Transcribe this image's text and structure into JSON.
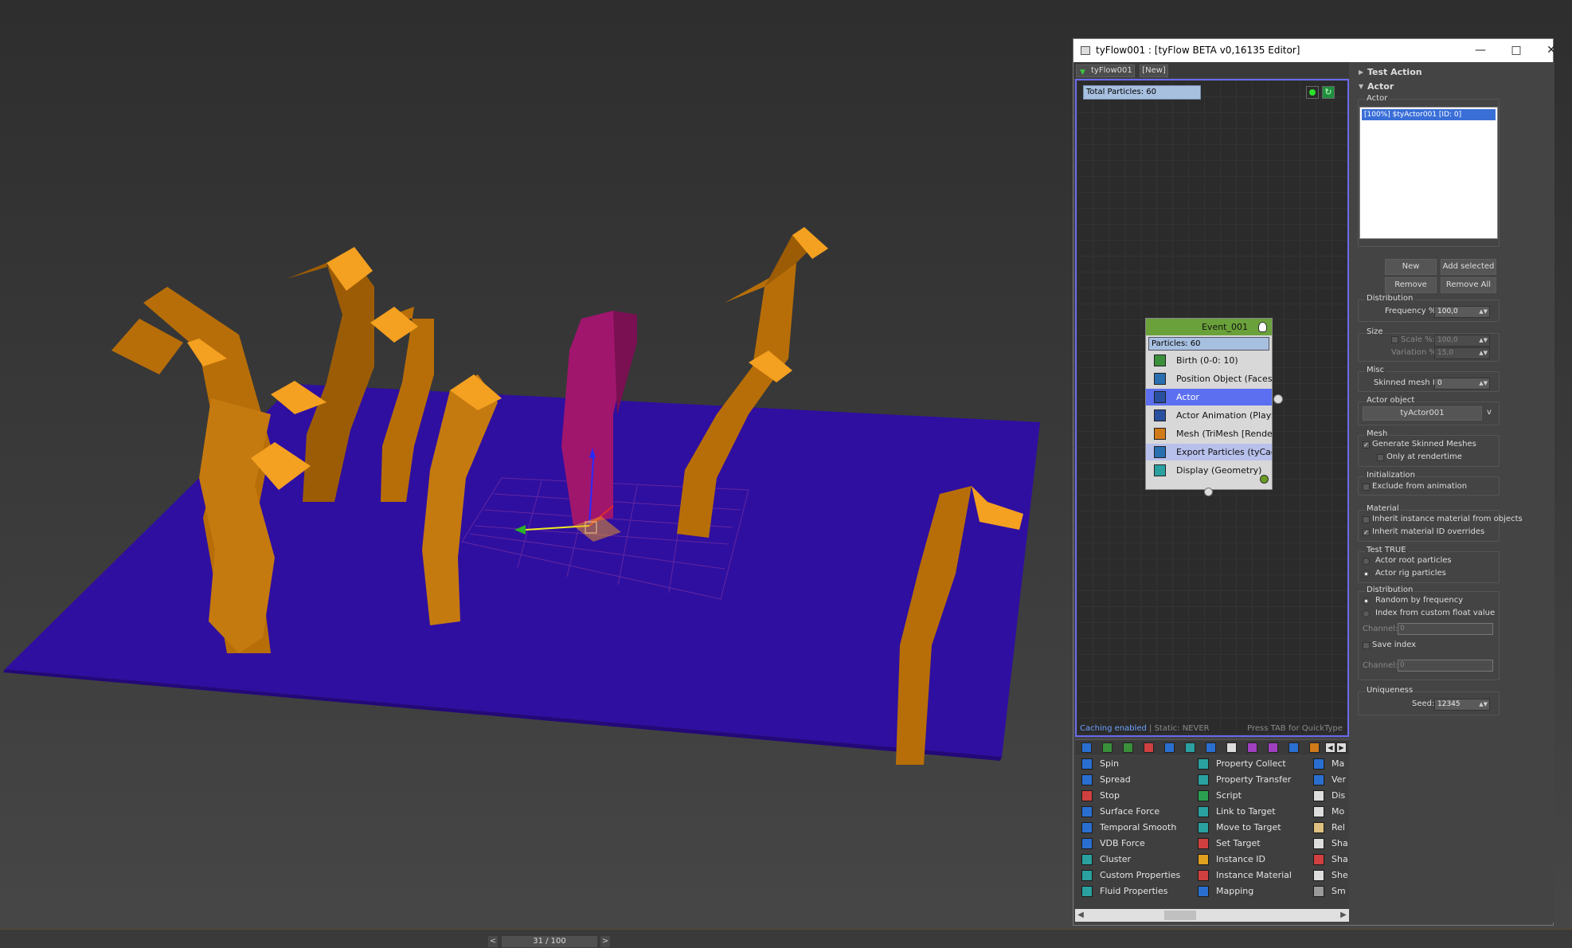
{
  "viewport": {
    "scene_label": "3D viewport",
    "colors": {
      "ground": "#2f0fa0",
      "branch": "#c57a10",
      "branch_cap": "#f4a020",
      "pink": "#a0166d",
      "grid": "#8a3aa0"
    }
  },
  "timeline": {
    "prev": "<",
    "frame": "31 / 100",
    "next": ">"
  },
  "window": {
    "title": "tyFlow001 : [tyFlow BETA v0,16135 Editor]",
    "min": "—",
    "max": "□",
    "close": "✕"
  },
  "tabs": {
    "flow": "tyFlow001",
    "new": "[New]"
  },
  "graph": {
    "total_particles": "Total Particles: 60",
    "refresh_glyph": "↻",
    "caching_enabled": "Caching enabled",
    "caching_rest": " | Static: NEVER",
    "quicktype": "Press TAB for QuickType"
  },
  "event": {
    "name": "Event_001",
    "particles": "Particles: 60",
    "operators": [
      {
        "label": "Birth (0-0: 10)",
        "icon": "birth-icon",
        "color": "#3a8f3a"
      },
      {
        "label": "Position Object (Faces)",
        "icon": "position-icon",
        "color": "#2a6fb0"
      },
      {
        "label": "Actor",
        "icon": "actor-icon",
        "color": "#2a50a0"
      },
      {
        "label": "Actor Animation (Play: \"An...",
        "icon": "actor-animation-icon",
        "color": "#2a50a0"
      },
      {
        "label": "Mesh (TriMesh [Render])",
        "icon": "mesh-icon",
        "color": "#d07a1a"
      },
      {
        "label": "Export Particles (tyCache)",
        "icon": "export-icon",
        "color": "#2a6fb0"
      },
      {
        "label": "Display (Geometry)",
        "icon": "display-icon",
        "color": "#2aa0a0"
      }
    ]
  },
  "palette": {
    "col1": [
      {
        "label": "Spin",
        "color": "#2a6fd0"
      },
      {
        "label": "Spread",
        "color": "#2a6fd0"
      },
      {
        "label": "Stop",
        "color": "#d04040"
      },
      {
        "label": "Surface Force",
        "color": "#2a6fd0"
      },
      {
        "label": "Temporal Smooth",
        "color": "#2a6fd0"
      },
      {
        "label": "VDB Force",
        "color": "#2a6fd0"
      },
      {
        "label": "Cluster",
        "color": "#2aa0a0"
      },
      {
        "label": "Custom Properties",
        "color": "#2aa0a0"
      },
      {
        "label": "Fluid Properties",
        "color": "#2aa0a0"
      }
    ],
    "col2": [
      {
        "label": "Property Collect",
        "color": "#2aa0a0"
      },
      {
        "label": "Property Transfer",
        "color": "#2aa0a0"
      },
      {
        "label": "Script",
        "color": "#2a9f50"
      },
      {
        "label": "Link to Target",
        "color": "#2aa0a0"
      },
      {
        "label": "Move to Target",
        "color": "#2aa0a0"
      },
      {
        "label": "Set Target",
        "color": "#d04040"
      },
      {
        "label": "Instance ID",
        "color": "#e0a020"
      },
      {
        "label": "Instance Material",
        "color": "#d04040"
      },
      {
        "label": "Mapping",
        "color": "#2a6fd0"
      }
    ],
    "col3": [
      {
        "label": "Ma",
        "color": "#2a6fd0"
      },
      {
        "label": "Ver",
        "color": "#2a6fd0"
      },
      {
        "label": "Dis",
        "color": "#ddd"
      },
      {
        "label": "Mo",
        "color": "#ddd"
      },
      {
        "label": "Rel",
        "color": "#e0c080"
      },
      {
        "label": "Sha",
        "color": "#ddd"
      },
      {
        "label": "Sha",
        "color": "#d04040"
      },
      {
        "label": "She",
        "color": "#ddd"
      },
      {
        "label": "Sm",
        "color": "#9a9a9a"
      }
    ]
  },
  "toolbar_icons": [
    "#2a6fd0",
    "#3a8f3a",
    "#3a8f3a",
    "#d04040",
    "#2a6fd0",
    "#2aa0a0",
    "#2a6fd0",
    "#ddd",
    "#a040c0",
    "#a040c0",
    "#2a6fd0",
    "#d07a1a"
  ],
  "props": {
    "test_action": "Test Action",
    "actor_rollout": "Actor",
    "actor_group": "Actor",
    "actor_item": "[100%] $tyActor001 [ID: 0]",
    "btn_new": "New",
    "btn_add_selected": "Add selected",
    "btn_remove": "Remove",
    "btn_remove_all": "Remove All",
    "distribution": "Distribution",
    "frequency_label": "Frequency %:",
    "frequency_value": "100,0",
    "size": "Size",
    "scale_label": "Scale %:",
    "scale_value": "100,0",
    "variation_label": "Variation %:",
    "variation_value": "15,0",
    "misc": "Misc",
    "skinned_mesh_label": "Skinned mesh ID:",
    "skinned_mesh_value": "0",
    "actor_object": "Actor object",
    "actor_object_value": "tyActor001",
    "actor_object_menu": "v",
    "mesh": "Mesh",
    "generate_skinned": "Generate Skinned Meshes",
    "only_rendertime": "Only at rendertime",
    "initialization": "Initialization",
    "exclude_anim": "Exclude from animation",
    "material": "Material",
    "inherit_instance": "Inherit instance material from objects",
    "inherit_matid": "Inherit material ID overrides",
    "test_true": "Test TRUE",
    "actor_root": "Actor root particles",
    "actor_rig": "Actor rig particles",
    "distribution2": "Distribution",
    "random_freq": "Random by frequency",
    "index_custom": "Index from custom float value",
    "channel_label": "Channel:",
    "channel_value": "0",
    "save_index": "Save index",
    "channel2_label": "Channel:",
    "channel2_value": "0",
    "uniqueness": "Uniqueness",
    "seed_label": "Seed:",
    "seed_value": "12345",
    "check_glyph": "✓",
    "spin_glyph": "▲▼"
  }
}
